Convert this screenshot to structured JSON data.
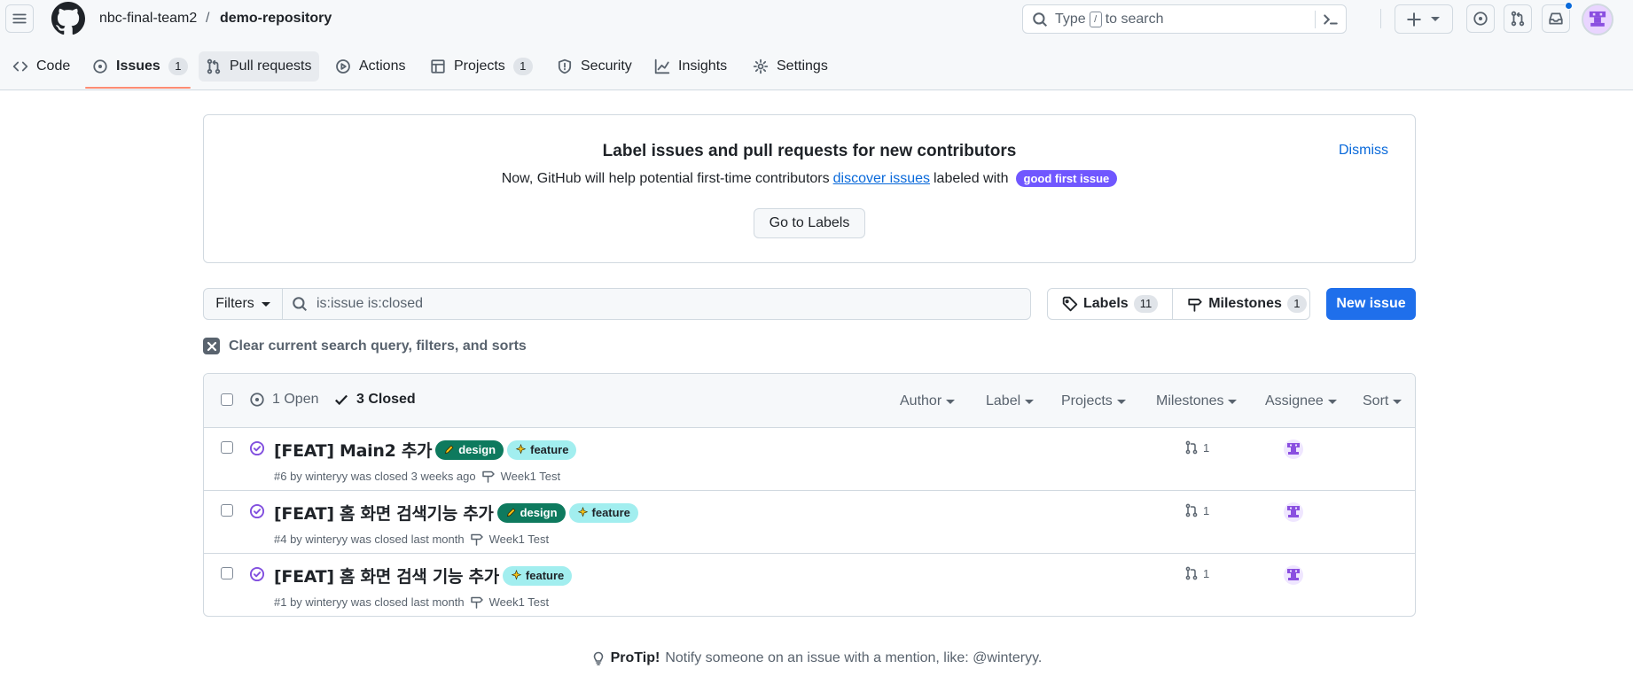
{
  "header": {
    "owner": "nbc-final-team2",
    "separator": "/",
    "repo": "demo-repository",
    "search_placeholder_pre": "Type",
    "search_key": "/",
    "search_placeholder_post": "to search"
  },
  "tabs": [
    {
      "label": "Code",
      "icon": "code-icon"
    },
    {
      "label": "Issues",
      "icon": "issue-open-icon",
      "count": "1"
    },
    {
      "label": "Pull requests",
      "icon": "git-pull-request-icon"
    },
    {
      "label": "Actions",
      "icon": "play-icon"
    },
    {
      "label": "Projects",
      "icon": "table-icon",
      "count": "1"
    },
    {
      "label": "Security",
      "icon": "shield-icon"
    },
    {
      "label": "Insights",
      "icon": "graph-icon"
    },
    {
      "label": "Settings",
      "icon": "gear-icon"
    }
  ],
  "banner": {
    "title": "Label issues and pull requests for new contributors",
    "text_pre": "Now, GitHub will help potential first-time contributors",
    "link": "discover issues",
    "text_post": "labeled with",
    "label": "good first issue",
    "dismiss": "Dismiss",
    "button": "Go to Labels"
  },
  "filters": {
    "filters_label": "Filters",
    "query": "is:issue is:closed",
    "labels_label": "Labels",
    "labels_count": "11",
    "milestones_label": "Milestones",
    "milestones_count": "1",
    "new_issue": "New issue",
    "clear_text": "Clear current search query, filters, and sorts"
  },
  "list_header": {
    "open": "1 Open",
    "closed": "3 Closed",
    "author": "Author",
    "label": "Label",
    "projects": "Projects",
    "milestones": "Milestones",
    "assignee": "Assignee",
    "sort": "Sort"
  },
  "issues": [
    {
      "title": "[FEAT] Main2 추가",
      "labels": [
        "design",
        "feature"
      ],
      "meta": "#6 by winteryy was closed 3 weeks ago",
      "milestone": "Week1 Test",
      "prs": "1"
    },
    {
      "title": "[FEAT] 홈 화면 검색기능 추가",
      "labels": [
        "design",
        "feature"
      ],
      "meta": "#4 by winteryy was closed last month",
      "milestone": "Week1 Test",
      "prs": "1"
    },
    {
      "title": "[FEAT] 홈 화면 검색 기능 추가",
      "labels": [
        "feature"
      ],
      "meta": "#1 by winteryy was closed last month",
      "milestone": "Week1 Test",
      "prs": "1"
    }
  ],
  "protip": {
    "bold": "ProTip!",
    "text": "Notify someone on an issue with a mention, like: @winteryy."
  },
  "colors": {
    "accent_blue": "#1f6feb",
    "closed_purple": "#8250df",
    "design_label": "#0e7a5e",
    "feature_label": "#a2eeef",
    "good_first_issue": "#7057ff",
    "tab_underline": "#fd8c73"
  }
}
